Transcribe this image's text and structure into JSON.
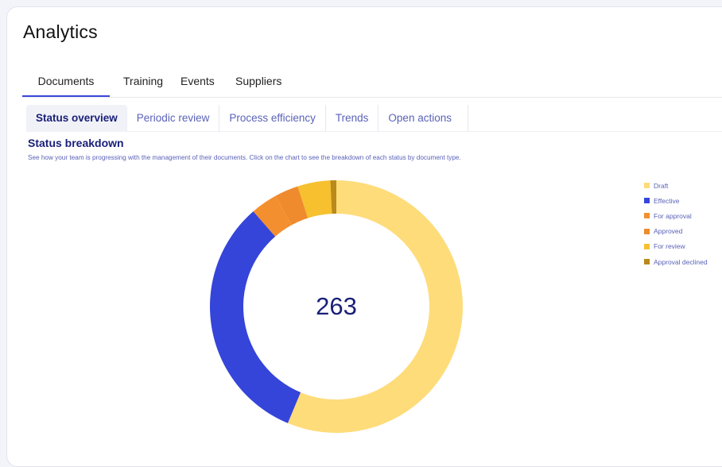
{
  "page": {
    "title": "Analytics"
  },
  "main_tabs": [
    {
      "label": "Documents",
      "active": true
    },
    {
      "label": "Training",
      "active": false
    },
    {
      "label": "Events",
      "active": false
    },
    {
      "label": "Suppliers",
      "active": false
    }
  ],
  "sub_tabs": [
    {
      "label": "Status overview",
      "active": true
    },
    {
      "label": "Periodic review",
      "active": false
    },
    {
      "label": "Process efficiency",
      "active": false
    },
    {
      "label": "Trends",
      "active": false
    },
    {
      "label": "Open actions",
      "active": false
    }
  ],
  "section": {
    "title": "Status breakdown",
    "description": "See how your team is progressing with the management of their documents.  Click on the chart to see the breakdown of each status by document type."
  },
  "colors": {
    "accent": "#3848d8",
    "heading": "#1a2078",
    "muted_text": "#5a62b8"
  },
  "chart_data": {
    "type": "pie",
    "variant": "donut",
    "center_label": "263",
    "legend_position": "right",
    "series": [
      {
        "name": "Draft",
        "value": 148,
        "color": "#fedc7a"
      },
      {
        "name": "Effective",
        "value": 85,
        "color": "#3545d9"
      },
      {
        "name": "For approval",
        "value": 9,
        "color": "#f48f30"
      },
      {
        "name": "Approved",
        "value": 8,
        "color": "#ef8b2d"
      },
      {
        "name": "For review",
        "value": 11,
        "color": "#f6c02f"
      },
      {
        "name": "Approval declined",
        "value": 2,
        "color": "#b98a1a"
      }
    ],
    "total": 263
  }
}
